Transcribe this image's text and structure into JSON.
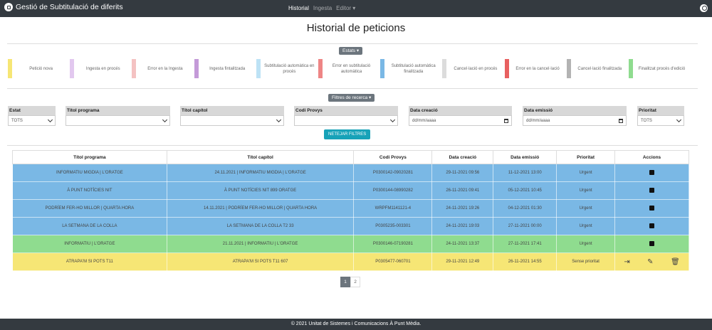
{
  "app": {
    "title": "Gestió de Subtitulació de diferits"
  },
  "nav": {
    "historial": "Historial",
    "ingesta": "Ingesta",
    "editor": "Editor ▾"
  },
  "page_title": "Historial de peticions",
  "estats_button": "Estats ▾",
  "legend": [
    {
      "label": "Petició nova",
      "color": "#f6e675"
    },
    {
      "label": "Ingesta en procés",
      "color": "#e2c8ef"
    },
    {
      "label": "Error en la Ingesta",
      "color": "#f4c2c2"
    },
    {
      "label": "Ingesta fintalitzada",
      "color": "#c49ad8"
    },
    {
      "label": "Subtitulació automàtica en procés",
      "color": "#bde2f5"
    },
    {
      "label": "Error en subtitulació automàtica",
      "color": "#ee8585"
    },
    {
      "label": "Subtitulació automàtica finalitzada",
      "color": "#7ab8e5"
    },
    {
      "label": "Cancel·lació en procés",
      "color": "#dcdcdc"
    },
    {
      "label": "Error en la cancel·lació",
      "color": "#e86060"
    },
    {
      "label": "Cancel·lació finalitzada",
      "color": "#b3b3b3"
    },
    {
      "label": "Finalitzat procés d'edició",
      "color": "#8fdc8f"
    }
  ],
  "filters_button": "Filtres de recerca ▾",
  "filters": {
    "estat": {
      "label": "Estat",
      "value": "TOTS"
    },
    "titol_programa": {
      "label": "Títol programa",
      "value": ""
    },
    "titol_capitol": {
      "label": "Títol capítol",
      "value": ""
    },
    "codi_provys": {
      "label": "Codi Provys",
      "value": ""
    },
    "data_creacio": {
      "label": "Data creació",
      "value": "dd/mm/aaaa"
    },
    "data_emissio": {
      "label": "Data emissió",
      "value": "dd/mm/aaaa"
    },
    "prioritat": {
      "label": "Prioritat",
      "value": "TOTS"
    }
  },
  "clear_button": "NETEJAR FILTRES",
  "table": {
    "headers": [
      "Títol programa",
      "Títol capítol",
      "Codi Provys",
      "Data creació",
      "Data emissió",
      "Prioritat",
      "Accions"
    ],
    "rows": [
      {
        "color": "#7ab8e5",
        "c": [
          "INFORMATIU MIGDIA | L'ORATGE",
          "24.11.2021 | INFORMATIU MIGDIA | L'ORATGE",
          "P0300142-09020281",
          "29-11-2021 09:56",
          "11-12-2021 13:00",
          "Urgent"
        ]
      },
      {
        "color": "#7ab8e5",
        "c": [
          "À PUNT NOTÍCIES NIT",
          "À PUNT NOTÍCIES NIT 899 ORATGE",
          "P0300144-08990282",
          "26-11-2021 09:41",
          "05-12-2021 10:45",
          "Urgent"
        ]
      },
      {
        "color": "#7ab8e5",
        "c": [
          "PODRÍEM FER-HO MILLOR | QUARTA HORA",
          "14.11.2021 | PODRÍEM FER-HO MILLOR | QUARTA HORA",
          "WRPFM1141121-4",
          "24-11-2021 19:26",
          "04-12-2021 01:30",
          "Urgent"
        ]
      },
      {
        "color": "#7ab8e5",
        "c": [
          "LA SETMANA DE LA COLLA",
          "LA SETMANA DE LA COLLA T2 33",
          "P0305235-003301",
          "24-11-2021 19:03",
          "27-11-2021 00:00",
          "Urgent"
        ]
      },
      {
        "color": "#8fdc8f",
        "c": [
          "INFORMATIU | L'ORATGE",
          "21.11.2021 | INFORMATIU | L'ORATGE",
          "P0300146-07190281",
          "24-11-2021 13:37",
          "27-11-2021 17:41",
          "Urgent"
        ]
      },
      {
        "color": "#f6e675",
        "c": [
          "ATRAPA'M SI POTS T11",
          "ATRAPA'M SI POTS T11 607",
          "P0305477-060701",
          "29-11-2021 12:49",
          "26-11-2021 14:55",
          "Sense prioritat"
        ]
      }
    ]
  },
  "pagination": [
    "1",
    "2"
  ],
  "footer": "© 2021 Unitat de Sistemes i Comunicacions À Punt Mèdia."
}
